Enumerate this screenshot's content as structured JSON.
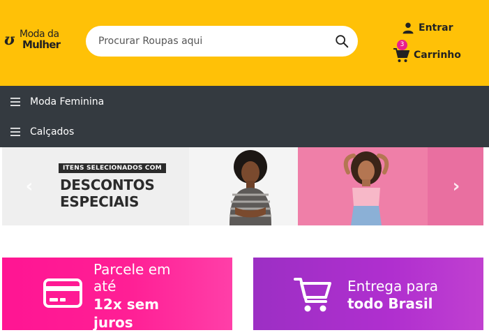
{
  "header": {
    "logo_text_top": "Moda da",
    "logo_text_bottom": "Mulher",
    "search_placeholder": "Procurar Roupas aqui",
    "login_label": "Entrar",
    "cart_label": "Carrinho",
    "cart_count": "3",
    "icons": [
      "search-icon",
      "user-icon",
      "cart-icon"
    ]
  },
  "nav": {
    "items": [
      {
        "label": "Moda Feminina",
        "icon": "hamburger-icon"
      },
      {
        "label": "Calçados",
        "icon": "hamburger-icon"
      }
    ]
  },
  "carousel": {
    "promo_small": "ITENS SELECIONADOS COM",
    "promo_big_1": "DESCONTOS",
    "promo_big_2": "ESPECIAIS",
    "prev_icon": "chevron-left-icon",
    "next_icon": "chevron-right-icon"
  },
  "features": [
    {
      "line1": "Parcele em até",
      "line2": "12x sem juros",
      "icon": "credit-card-icon"
    },
    {
      "line1": "Entrega para",
      "line2": "todo Brasil",
      "icon": "cart-icon"
    }
  ],
  "colors": {
    "header_bg": "#ffc107",
    "nav_bg": "#343a40",
    "pink": "#ff1593",
    "purple": "#a52fc8",
    "badge": "#e91e8c"
  }
}
